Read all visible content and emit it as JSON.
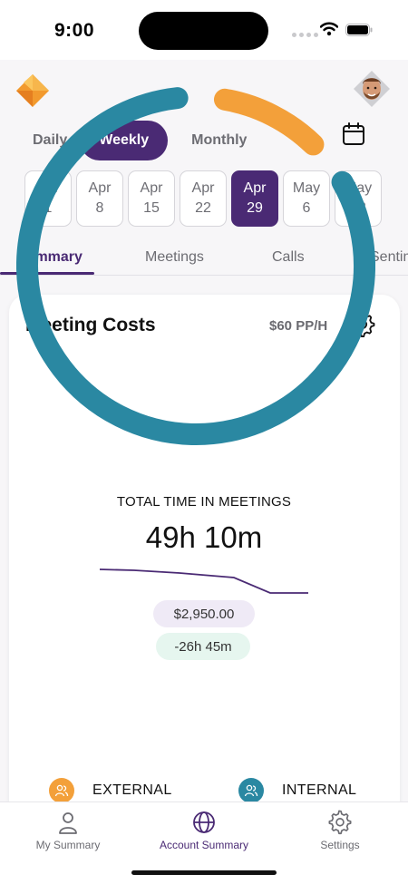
{
  "status_bar": {
    "time": "9:00"
  },
  "period_toggle": {
    "options": [
      "Daily",
      "Weekly",
      "Monthly"
    ],
    "selected": "Weekly"
  },
  "weeks": [
    {
      "month": "Apr",
      "day": "1"
    },
    {
      "month": "Apr",
      "day": "8"
    },
    {
      "month": "Apr",
      "day": "15"
    },
    {
      "month": "Apr",
      "day": "22"
    },
    {
      "month": "Apr",
      "day": "29"
    },
    {
      "month": "May",
      "day": "6"
    },
    {
      "month": "May",
      "day": "13"
    }
  ],
  "selected_week_index": 4,
  "tabs": [
    "Summary",
    "Meetings",
    "Calls",
    "Sentiment"
  ],
  "active_tab": "Summary",
  "card": {
    "title": "Meeting Costs",
    "rate": "$60 PP/H",
    "center_label": "TOTAL TIME IN MEETINGS",
    "total_time": "49h 10m",
    "cost": "$2,950.00",
    "delta": "-26h 45m"
  },
  "ring_segments": [
    {
      "category": "external",
      "fraction": 0.14,
      "color": "#f3a03a"
    },
    {
      "category": "internal",
      "fraction": 0.86,
      "color": "#2a88a2"
    }
  ],
  "legend": [
    {
      "label": "EXTERNAL",
      "color": "#f3a03a"
    },
    {
      "label": "INTERNAL",
      "color": "#2a88a2"
    }
  ],
  "bottom_nav": [
    {
      "label": "My Summary",
      "icon": "person-icon"
    },
    {
      "label": "Account Summary",
      "icon": "globe-icon"
    },
    {
      "label": "Settings",
      "icon": "gear-icon"
    }
  ],
  "active_nav": "Account Summary",
  "colors": {
    "brand_purple": "#4a2a74",
    "external_orange": "#f3a03a",
    "internal_teal": "#2a88a2"
  }
}
